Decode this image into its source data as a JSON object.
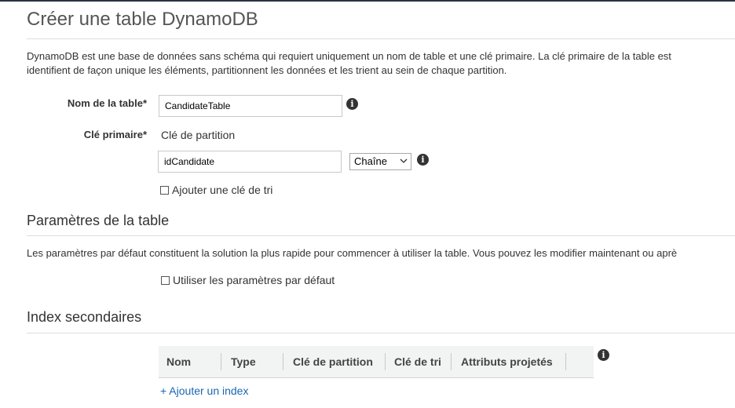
{
  "page": {
    "title": "Créer une table DynamoDB",
    "description_line1": "DynamoDB est une base de données sans schéma qui requiert uniquement un nom de table et une clé primaire. La clé primaire de la table est",
    "description_line2": "identifient de façon unique les éléments, partitionnent les données et les trient au sein de chaque partition."
  },
  "form": {
    "table_name_label": "Nom de la table*",
    "table_name_value": "CandidateTable",
    "primary_key_label": "Clé primaire*",
    "partition_key_label": "Clé de partition",
    "partition_key_value": "idCandidate",
    "partition_key_type": "Chaîne",
    "add_sort_key_label": "Ajouter une clé de tri",
    "add_sort_key_checked": false
  },
  "table_settings": {
    "title": "Paramètres de la table",
    "description": "Les paramètres par défaut constituent la solution la plus rapide pour commencer à utiliser la table. Vous pouvez les modifier maintenant ou aprè",
    "use_defaults_label": "Utiliser les paramètres par défaut",
    "use_defaults_checked": false
  },
  "secondary_indexes": {
    "title": "Index secondaires",
    "columns": [
      "Nom",
      "Type",
      "Clé de partition",
      "Clé de tri",
      "Attributs projetés"
    ],
    "rows": [],
    "add_link": "+ Ajouter un index"
  },
  "icons": {
    "info": "info-icon",
    "dropdown": "chevron-down-icon"
  },
  "colors": {
    "link": "#1a66b3",
    "header_bg": "#f2f3f3",
    "info_icon": "#333333"
  }
}
